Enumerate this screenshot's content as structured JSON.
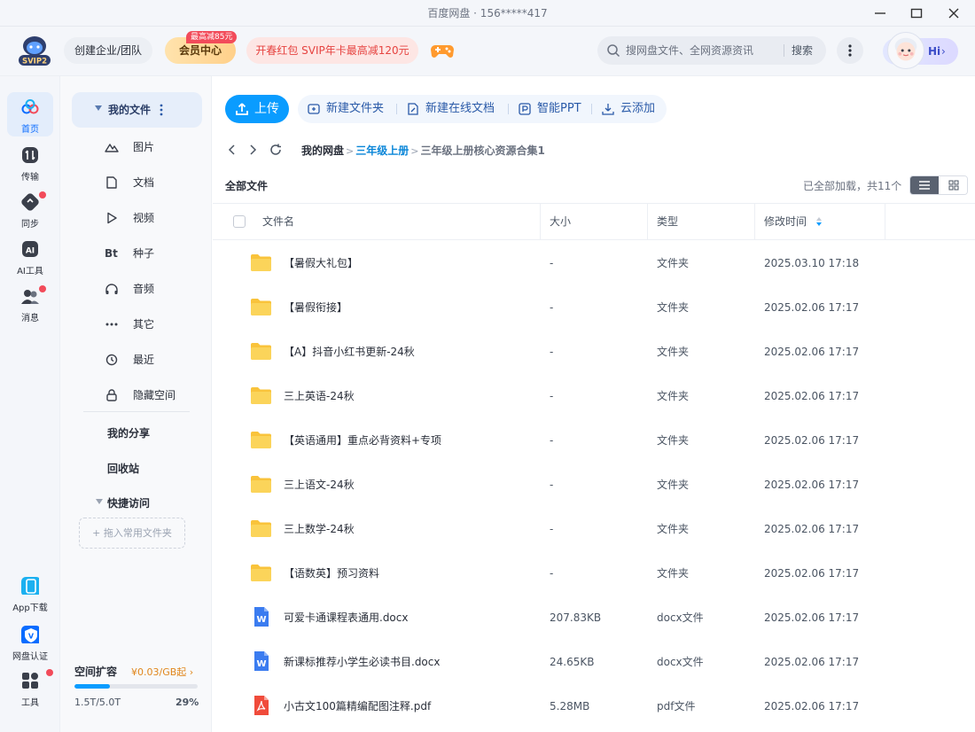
{
  "window": {
    "title": "百度网盘 · 156*****417"
  },
  "header": {
    "logo_label": "SVIP2",
    "team_button": "创建企业/团队",
    "vip_center": "会员中心",
    "vip_badge": "最高减85元",
    "promo": "开春红包 SVIP年卡最高减120元",
    "search_placeholder": "搜网盘文件、全网资源资讯",
    "search_button": "搜索",
    "user_greeting": "Hi",
    "user_chevron": "›"
  },
  "rail": {
    "items": [
      {
        "label": "首页",
        "icon": "cloud-icon",
        "active": true,
        "dot": false
      },
      {
        "label": "传输",
        "icon": "transfer-icon",
        "active": false,
        "dot": false
      },
      {
        "label": "同步",
        "icon": "sync-icon",
        "active": false,
        "dot": true
      },
      {
        "label": "AI工具",
        "icon": "ai-icon",
        "active": false,
        "dot": false
      },
      {
        "label": "消息",
        "icon": "message-icon",
        "active": false,
        "dot": true
      }
    ],
    "bottom": [
      {
        "label": "App下载",
        "icon": "phone-icon"
      },
      {
        "label": "网盘认证",
        "icon": "verify-icon"
      },
      {
        "label": "工具",
        "icon": "apps-icon",
        "dot": true
      }
    ]
  },
  "sidebar": {
    "my_files": "我的文件",
    "categories": [
      {
        "label": "图片",
        "icon": "image-icon"
      },
      {
        "label": "文档",
        "icon": "document-icon"
      },
      {
        "label": "视频",
        "icon": "video-icon"
      },
      {
        "label": "种子",
        "icon": "torrent-icon",
        "glyph": "Bt"
      },
      {
        "label": "音频",
        "icon": "audio-icon"
      },
      {
        "label": "其它",
        "icon": "more-icon"
      },
      {
        "label": "最近",
        "icon": "recent-icon"
      },
      {
        "label": "隐藏空间",
        "icon": "lock-icon"
      }
    ],
    "my_share": "我的分享",
    "recycle": "回收站",
    "quick_access": "快捷访问",
    "drop_hint": "+ 拖入常用文件夹",
    "storage": {
      "title": "空间扩容",
      "price": "¥0.03/GB起",
      "price_chevron": "›",
      "used": "1.5T/5.0T",
      "percent_label": "29%",
      "percent": 29
    }
  },
  "toolbar": {
    "upload": "上传",
    "actions": [
      {
        "label": "新建文件夹",
        "icon": "new-folder-icon"
      },
      {
        "label": "新建在线文档",
        "icon": "online-doc-icon"
      },
      {
        "label": "智能PPT",
        "icon": "ppt-icon"
      },
      {
        "label": "云添加",
        "icon": "cloud-add-icon"
      }
    ]
  },
  "breadcrumb": {
    "items": [
      "我的网盘",
      "三年级上册",
      "三年级上册核心资源合集1"
    ],
    "separator": ">"
  },
  "list": {
    "title": "全部文件",
    "status": "已全部加载，共11个",
    "columns": {
      "name": "文件名",
      "size": "大小",
      "type": "类型",
      "mtime": "修改时间"
    },
    "rows": [
      {
        "name": "【暑假大礼包】",
        "size": "-",
        "type": "文件夹",
        "mtime": "2025.03.10 17:18",
        "kind": "folder"
      },
      {
        "name": "【暑假衔接】",
        "size": "-",
        "type": "文件夹",
        "mtime": "2025.02.06 17:17",
        "kind": "folder"
      },
      {
        "name": "【A】抖音小红书更新-24秋",
        "size": "-",
        "type": "文件夹",
        "mtime": "2025.02.06 17:17",
        "kind": "folder"
      },
      {
        "name": "三上英语-24秋",
        "size": "-",
        "type": "文件夹",
        "mtime": "2025.02.06 17:17",
        "kind": "folder"
      },
      {
        "name": "【英语通用】重点必背资料+专项",
        "size": "-",
        "type": "文件夹",
        "mtime": "2025.02.06 17:17",
        "kind": "folder"
      },
      {
        "name": "三上语文-24秋",
        "size": "-",
        "type": "文件夹",
        "mtime": "2025.02.06 17:17",
        "kind": "folder"
      },
      {
        "name": "三上数学-24秋",
        "size": "-",
        "type": "文件夹",
        "mtime": "2025.02.06 17:17",
        "kind": "folder"
      },
      {
        "name": "【语数英】预习资料",
        "size": "-",
        "type": "文件夹",
        "mtime": "2025.02.06 17:17",
        "kind": "folder"
      },
      {
        "name": "可爱卡通课程表通用.docx",
        "size": "207.83KB",
        "type": "docx文件",
        "mtime": "2025.02.06 17:17",
        "kind": "docx"
      },
      {
        "name": "新课标推荐小学生必读书目.docx",
        "size": "24.65KB",
        "type": "docx文件",
        "mtime": "2025.02.06 17:17",
        "kind": "docx"
      },
      {
        "name": "小古文100篇精编配图注释.pdf",
        "size": "5.28MB",
        "type": "pdf文件",
        "mtime": "2025.02.06 17:17",
        "kind": "pdf"
      }
    ]
  },
  "colors": {
    "accent": "#0a9cff",
    "link": "#0a86d8",
    "folder": "#f9c33b",
    "docx": "#3b7cf0",
    "pdf": "#f04b3b",
    "badge": "#f24b5a"
  }
}
